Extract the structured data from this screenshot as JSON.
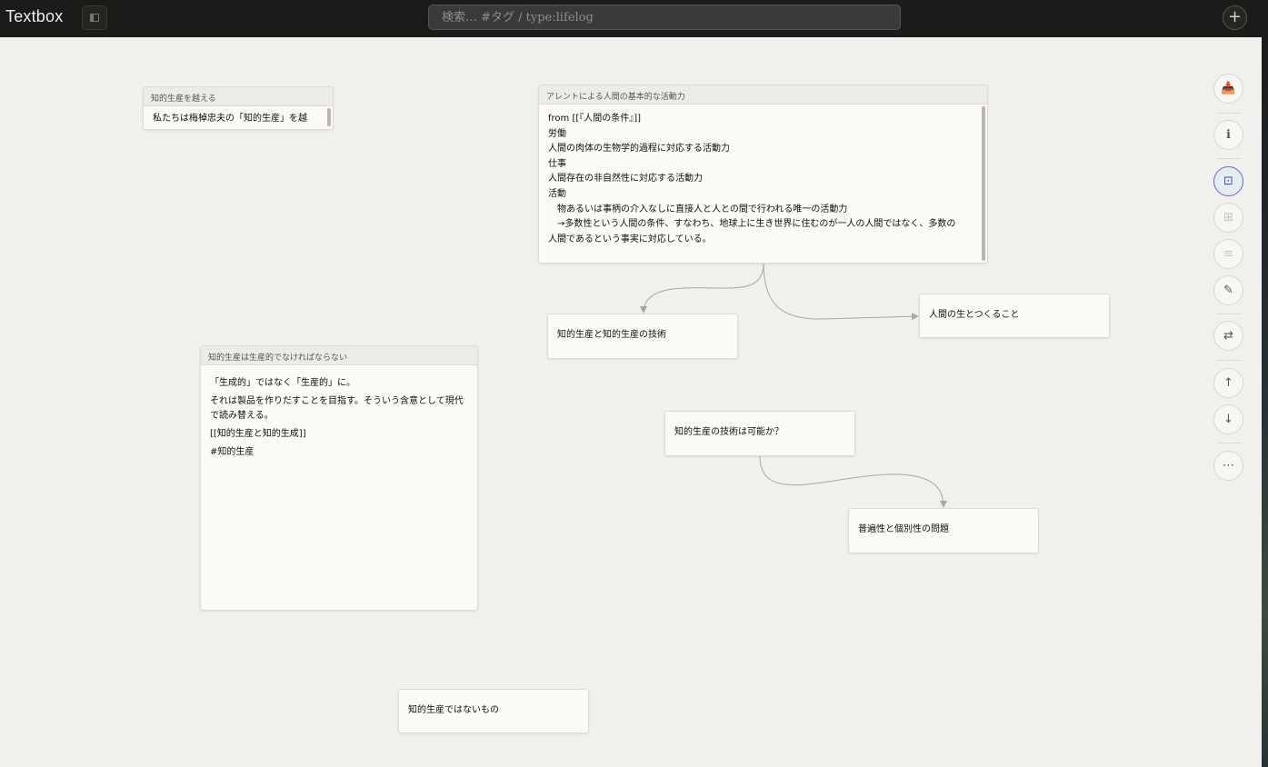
{
  "app": {
    "title": "Textbox",
    "search_placeholder": "検索… #タグ / type:lifelog",
    "add_label": "+"
  },
  "cards": {
    "beyond": {
      "header": "知的生産を越える",
      "body": "私たちは梅棹忠夫の「知的生産」を越"
    },
    "arendt": {
      "header": "アレントによる人間の基本的な活動力",
      "lines": [
        "from [[『人間の条件』]]",
        "労働",
        "人間の肉体の生物学的過程に対応する活動力",
        "仕事",
        "人間存在の非自然性に対応する活動力",
        "活動",
        "　物あるいは事柄の介入なしに直接人と人との間で行われる唯一の活動力",
        "　→多数性という人間の条件、すなわち、地球上に生き世界に住むのが一人の人間ではなく、多数の人間であるという事実に対応している。"
      ]
    },
    "tech": {
      "body": "知的生産と知的生産の技術"
    },
    "life": {
      "body": "人間の生とつくること"
    },
    "productive": {
      "header": "知的生産は生産的でなければならない",
      "paragraphs": [
        "「生成的」ではなく「生産的」に。",
        "それは製品を作りだすことを目指す。そういう含意として現代で読み替える。",
        "[[知的生産と知的生成]]",
        "#知的生産"
      ]
    },
    "possible": {
      "body": "知的生産の技術は可能か？"
    },
    "universal": {
      "body": "普遍性と個別性の問題"
    },
    "notproductive": {
      "body": "知的生産ではないもの"
    }
  },
  "toolbar": {
    "archive_icon": "📥",
    "info_icon": "ℹ",
    "focus_icon": "⊡",
    "grid_icon": "⊞",
    "list_icon": "≡",
    "pen_icon": "✎",
    "swap_icon": "⇄",
    "up_icon": "↑",
    "down_icon": "↓",
    "more_icon": "⋯"
  },
  "colors": {
    "canvas": "#f2f0ec",
    "topbar": "#1c1b19",
    "accent": "#5a6ec4",
    "connector": "#a9a7a2"
  }
}
